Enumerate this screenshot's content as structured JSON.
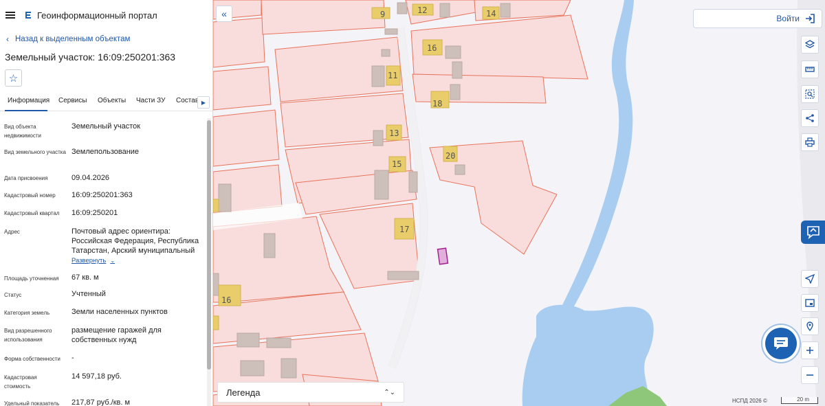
{
  "app": {
    "title": "Геоинформационный портал"
  },
  "nav": {
    "back_label": "Назад к выделенным объектам"
  },
  "object": {
    "title": "Земельный участок: 16:09:250201:363"
  },
  "tabs": [
    {
      "label": "Информация"
    },
    {
      "label": "Сервисы"
    },
    {
      "label": "Объекты"
    },
    {
      "label": "Части ЗУ"
    },
    {
      "label": "Состав"
    }
  ],
  "attributes": [
    {
      "label": "Вид объекта недвижимости",
      "value": "Земельный участок"
    },
    {
      "label": "Вид земельного участка",
      "value": "Землепользование"
    },
    {
      "label": "Дата присвоения",
      "value": "09.04.2026"
    },
    {
      "label": "Кадастровый номер",
      "value": "16:09:250201:363"
    },
    {
      "label": "Кадастровый квартал",
      "value": "16:09:250201"
    },
    {
      "label": "Адрес",
      "value": "Почтовый адрес ориентира: Российская Федерация, Республика Татарстан, Арский муниципальный"
    },
    {
      "label": "Площадь уточненная",
      "value": "67 кв. м"
    },
    {
      "label": "Статус",
      "value": "Учтенный"
    },
    {
      "label": "Категория земель",
      "value": "Земли населенных пунктов"
    },
    {
      "label": "Вид разрешенного использования",
      "value": "размещение гаражей для собственных нужд"
    },
    {
      "label": "Форма собственности",
      "value": "-"
    },
    {
      "label": "Кадастровая стоимость",
      "value": "14 597,18 руб."
    },
    {
      "label": "Удельный показатель",
      "value": "217,87 руб./кв. м"
    }
  ],
  "address_expand_label": "Развернуть",
  "map": {
    "house_numbers": [
      "9",
      "12",
      "14",
      "16",
      "11",
      "18",
      "13",
      "20",
      "15",
      "17",
      "16"
    ],
    "login_label": "Войти",
    "legend_label": "Легенда",
    "copyright": "НСПД 2026 ©",
    "scale_label": "20 m"
  },
  "colors": {
    "accent": "#1e63b3",
    "parcel_fill": "#f9dcdc",
    "parcel_stroke": "#e8735a",
    "building": "#e9cd6a",
    "water": "#a9cdf0",
    "selected": "#a3238f"
  }
}
